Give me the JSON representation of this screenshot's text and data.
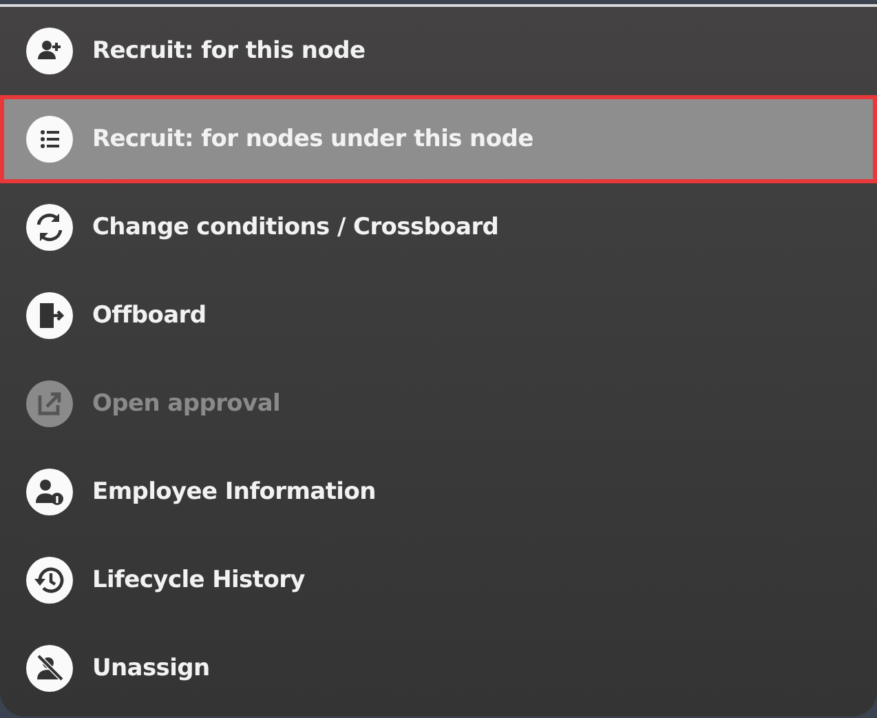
{
  "menu": {
    "items": [
      {
        "label": "Recruit: for this node",
        "selected": false,
        "disabled": false
      },
      {
        "label": "Recruit: for nodes under this node",
        "selected": true,
        "disabled": false
      },
      {
        "label": "Change conditions / Crossboard",
        "selected": false,
        "disabled": false
      },
      {
        "label": "Offboard",
        "selected": false,
        "disabled": false
      },
      {
        "label": "Open approval",
        "selected": false,
        "disabled": true
      },
      {
        "label": "Employee Information",
        "selected": false,
        "disabled": false
      },
      {
        "label": "Lifecycle History",
        "selected": false,
        "disabled": false
      },
      {
        "label": "Unassign",
        "selected": false,
        "disabled": false
      }
    ]
  }
}
